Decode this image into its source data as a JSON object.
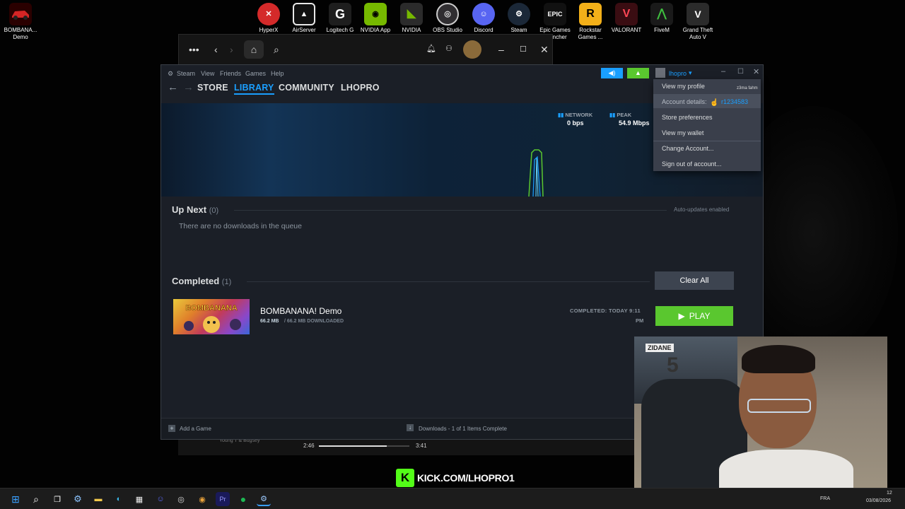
{
  "desktop": {
    "icons": [
      {
        "label": "BOMBANA...\nDemo",
        "icon": "red-car-icon",
        "color": "#d52525"
      },
      {
        "label": "HyperX",
        "icon": "hyperx-icon",
        "color": "#d42a2a"
      },
      {
        "label": "AirServer",
        "icon": "airserver-icon",
        "color": "#e8e8e8"
      },
      {
        "label": "Logitech G",
        "icon": "logitech-icon",
        "color": "#1e1e1e"
      },
      {
        "label": "NVIDIA App",
        "icon": "nvidia-app-icon",
        "color": "#76b900"
      },
      {
        "label": "NVIDIA",
        "icon": "nvidia-icon",
        "color": "#2b2b2b"
      },
      {
        "label": "OBS Studio",
        "icon": "obs-icon",
        "color": "#302e31"
      },
      {
        "label": "Discord",
        "icon": "discord-icon",
        "color": "#5865f2"
      },
      {
        "label": "Steam",
        "icon": "steam-icon",
        "color": "#1b2838"
      },
      {
        "label": "Epic Games\nLauncher",
        "icon": "epic-icon",
        "color": "#111111"
      },
      {
        "label": "Rockstar\nGames ...",
        "icon": "rockstar-icon",
        "color": "#f3b019"
      },
      {
        "label": "VALORANT",
        "icon": "valorant-icon",
        "color": "#ff4655"
      },
      {
        "label": "FiveM",
        "icon": "fivem-icon",
        "color": "#1a1a1a"
      },
      {
        "label": "Grand Theft\nAuto V",
        "icon": "gta-icon",
        "color": "#2b2b2b"
      }
    ]
  },
  "steam": {
    "menu": [
      "Steam",
      "View",
      "Friends",
      "Games",
      "Help"
    ],
    "tabs": {
      "store": "STORE",
      "library": "LIBRARY",
      "community": "COMMUNITY",
      "profile": "LHOPRO"
    },
    "username": "lhopro",
    "network": {
      "label": "NETWORK",
      "value": "0 bps",
      "peak_label": "PEAK",
      "peak_value": "54.9 Mbps"
    },
    "up_next": {
      "title": "Up Next",
      "count": "(0)",
      "empty_text": "There are no downloads in the queue",
      "auto_updates": "Auto-updates enabled"
    },
    "completed": {
      "title": "Completed",
      "count": "(1)",
      "clear_label": "Clear All",
      "game_title": "BOMBANANA! Demo",
      "size_done": "66.2 MB",
      "size_rest": "/ 66.2 MB DOWNLOADED",
      "completed_line1": "COMPLETED: TODAY 9:11",
      "completed_line2": "PM",
      "play_label": "PLAY"
    },
    "footer": {
      "add_game": "Add a Game",
      "downloads": "Downloads - 1 of 1 Items Complete"
    },
    "account_menu": {
      "items": [
        "View my profile",
        "Account details:",
        "Store preferences",
        "View my wallet",
        "Change Account...",
        "Sign out of account..."
      ],
      "account_id": "r1234583"
    }
  },
  "media": {
    "artist": "Young T & Bugsey",
    "elapsed": "2:46",
    "total": "3:41",
    "progress": 0.75
  },
  "overlay": {
    "kick": "KICK.COM/LHOPRO1",
    "jersey_name": "ZIDANE",
    "jersey_number": "5",
    "chat_text": "z3ma fahm"
  },
  "taskbar": {
    "lang": "FRA",
    "time": "12",
    "date": "03/08/2026"
  },
  "colors": {
    "accent": "#1a9fff",
    "play": "#5ac72f",
    "kick": "#53fc18"
  }
}
